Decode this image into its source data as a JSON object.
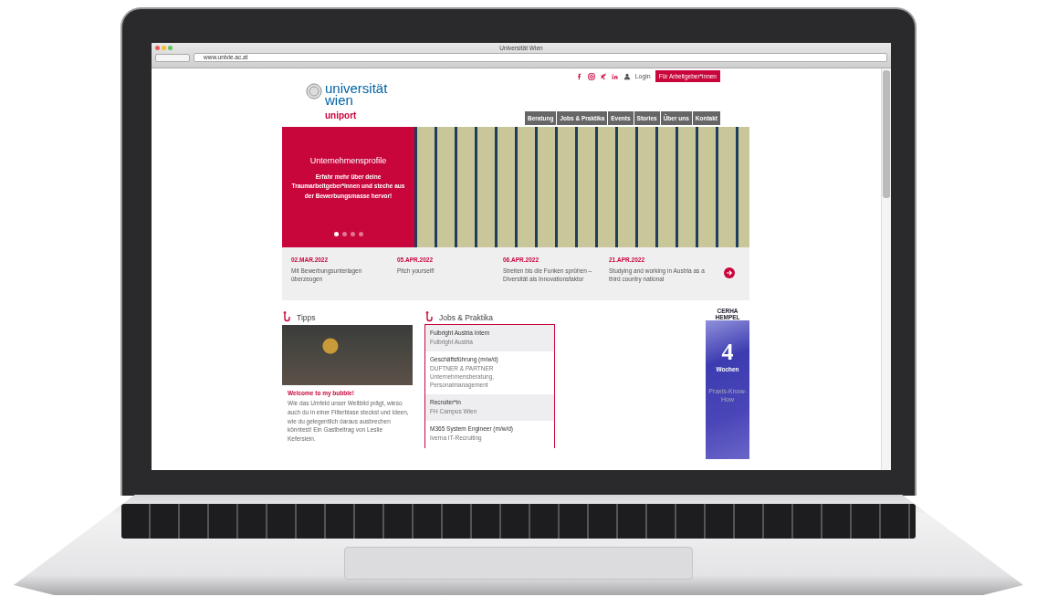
{
  "browser": {
    "title": "Universität Wien",
    "url": "www.univie.ac.at"
  },
  "topbar": {
    "login": "Login",
    "employer_button": "Für Arbeitgeber*innen"
  },
  "logo": {
    "line_1": "universität",
    "line_2": "wien",
    "product": "uniport"
  },
  "nav": [
    "Beratung",
    "Jobs & Praktika",
    "Events",
    "Stories",
    "Über uns",
    "Kontakt"
  ],
  "hero": {
    "title": "Unternehmensprofile",
    "text": "Erfahr mehr über deine Traumarbeitgeber*innen und steche aus der Bewerbungsmasse hervor!",
    "dots": [
      {
        "selected": true
      },
      {
        "selected": false
      },
      {
        "selected": false
      },
      {
        "selected": false
      }
    ]
  },
  "events": [
    {
      "date": "02.MAR.2022",
      "title": "Mit Bewerbungsunterlagen überzeugen"
    },
    {
      "date": "05.APR.2022",
      "title": "Pitch yourself!"
    },
    {
      "date": "06.APR.2022",
      "title": "Streiten bis die Funken sprühen – Diversität als Innovationsfaktor"
    },
    {
      "date": "21.APR.2022",
      "title": "Studying and working in Austria as a third country national"
    }
  ],
  "tipps": {
    "heading": "Tipps",
    "article_title": "Welcome to my bubble!",
    "article_text": "Wie das Umfeld unser Weltbild prägt, wieso auch du in einer Filterblase steckst und Ideen, wie du gelegentlich daraus ausbrechen könntest! Ein Gastbeitrag von Leslie Kefersiein."
  },
  "jobs": {
    "heading": "Jobs & Praktika",
    "items": [
      {
        "title": "Fulbright Austria Intern",
        "company": "Fulbright Austria"
      },
      {
        "title": "Geschäftsführung (m/w/d)",
        "company": "DUFTNER & PARTNER Unternehmensberatung, Personalmanagement"
      },
      {
        "title": "Recruiter*in",
        "company": "FH Campus Wien"
      },
      {
        "title": "M365 System Engineer (m/w/d)",
        "company": "Iverna IT-Recruiting"
      }
    ]
  },
  "ad": {
    "brand": "CERHA HEMPEL",
    "number": "4",
    "unit": "Wochen",
    "tagline": "Praxis-Know-How"
  }
}
